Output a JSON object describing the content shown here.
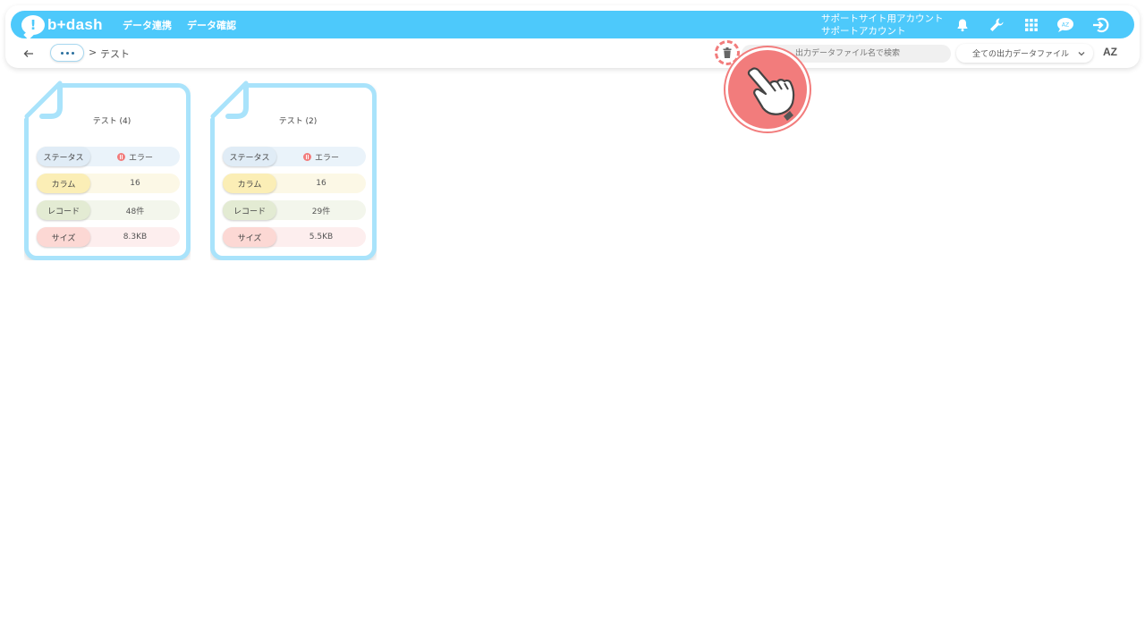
{
  "app": {
    "logo_text": "b+dash",
    "logo_mark": "!"
  },
  "nav": {
    "items": [
      "データ連携",
      "データ確認"
    ]
  },
  "account": {
    "line1": "サポートサイト用アカウント",
    "line2": "サポートアカウント"
  },
  "icons": {
    "bell": "bell-icon",
    "wrench": "wrench-icon",
    "grid": "grid-icon",
    "chat": "chat-icon",
    "logout": "logout-icon"
  },
  "breadcrumb": {
    "separator": ">",
    "current": "テスト"
  },
  "search": {
    "placeholder": "出力データファイル名で検索"
  },
  "filter": {
    "selected": "全ての出力データファイル"
  },
  "sort": {
    "label": "AZ"
  },
  "colors": {
    "accent": "#4dc9fb",
    "error": "#f27c7c"
  },
  "cards": [
    {
      "title": "テスト (4)",
      "status_label": "ステータス",
      "status": "エラー",
      "column_label": "カラム",
      "columns": "16",
      "record_label": "レコード",
      "records": "48件",
      "size_label": "サイズ",
      "size": "8.3KB"
    },
    {
      "title": "テスト (2)",
      "status_label": "ステータス",
      "status": "エラー",
      "column_label": "カラム",
      "columns": "16",
      "record_label": "レコード",
      "records": "29件",
      "size_label": "サイズ",
      "size": "5.5KB"
    }
  ]
}
